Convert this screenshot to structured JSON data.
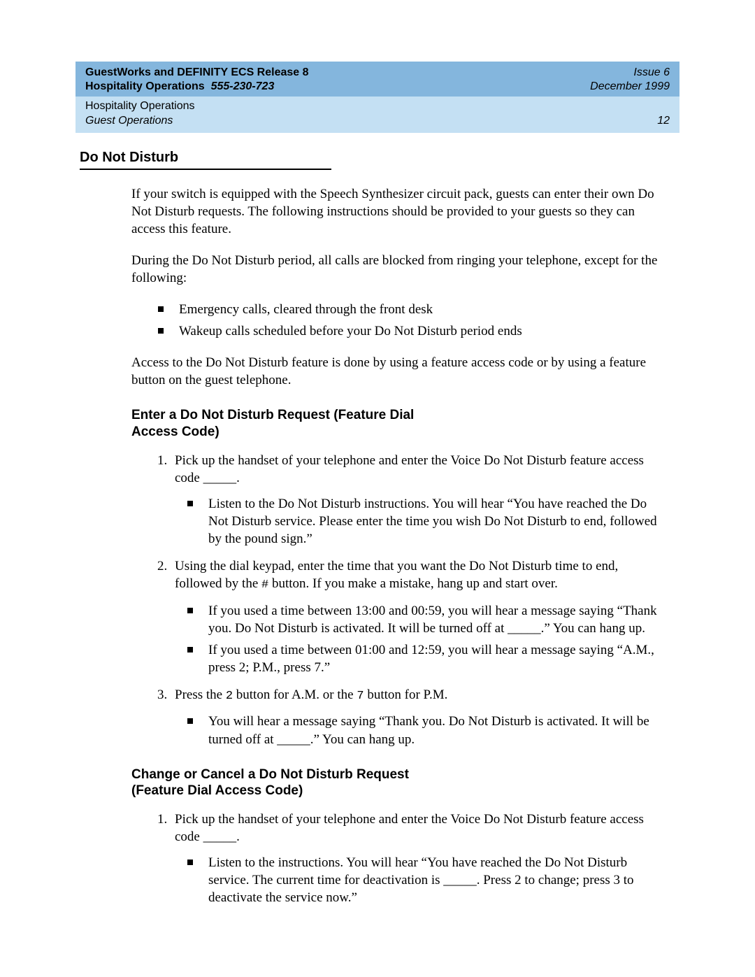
{
  "header": {
    "title": "GuestWorks and DEFINITY ECS Release 8",
    "subtitle_prefix": "Hospitality Operations",
    "doc_number": "555-230-723",
    "issue": "Issue 6",
    "date": "December 1999",
    "chapter": "Hospitality Operations",
    "section": "Guest Operations",
    "page": "12"
  },
  "body": {
    "h1": "Do Not Disturb",
    "p1": "If your switch is equipped with the Speech Synthesizer circuit pack, guests can enter their own Do Not Disturb requests. The following instructions should be provided to your guests so they can access this feature.",
    "p2": "During the Do Not Disturb period, all calls are blocked from ringing your telephone, except for the following:",
    "exceptions": [
      "Emergency calls, cleared through the front desk",
      "Wakeup calls scheduled before your Do Not Disturb period ends"
    ],
    "p3": "Access to the Do Not Disturb feature is done by using a feature access code or by using a feature button on the guest telephone.",
    "h2a": "Enter a Do Not Disturb Request (Feature Dial Access Code)",
    "ol1": {
      "i1": "Pick up the handset of your telephone and enter the Voice Do Not Disturb feature access code _____.",
      "i1_sub": [
        "Listen to the Do Not Disturb instructions. You will hear “You have reached the Do Not Disturb service. Please enter the time you wish Do Not Disturb to end, followed by the pound sign.”"
      ],
      "i2_pre": "Using the dial keypad, enter the time that you want the Do Not Disturb time to end, followed by the ",
      "i2_code": "#",
      "i2_post": " button. If you make a mistake, hang up and start over.",
      "i2_sub": [
        "If you used a time between 13:00 and 00:59, you will hear a message saying “Thank you. Do Not Disturb is activated. It will be turned off at _____.” You can hang up.",
        "If you used a time between 01:00 and 12:59, you will hear a message saying “A.M., press 2; P.M., press 7.”"
      ],
      "i3_pre": "Press the ",
      "i3_c1": "2",
      "i3_mid": " button for A.M. or the ",
      "i3_c2": "7",
      "i3_post": " button for P.M.",
      "i3_sub": [
        "You will hear a message saying “Thank you. Do Not Disturb is activated. It will be turned off at _____.” You can hang up."
      ]
    },
    "h2b": "Change or Cancel a Do Not Disturb Request (Feature Dial Access Code)",
    "ol2": {
      "i1": "Pick up the handset of your telephone and enter the Voice Do Not Disturb feature access code _____.",
      "i1_sub": [
        "Listen to the instructions. You will hear “You have reached the Do Not Disturb service. The current time for deactivation is _____. Press 2 to change; press 3 to deactivate the service now.”"
      ]
    }
  }
}
